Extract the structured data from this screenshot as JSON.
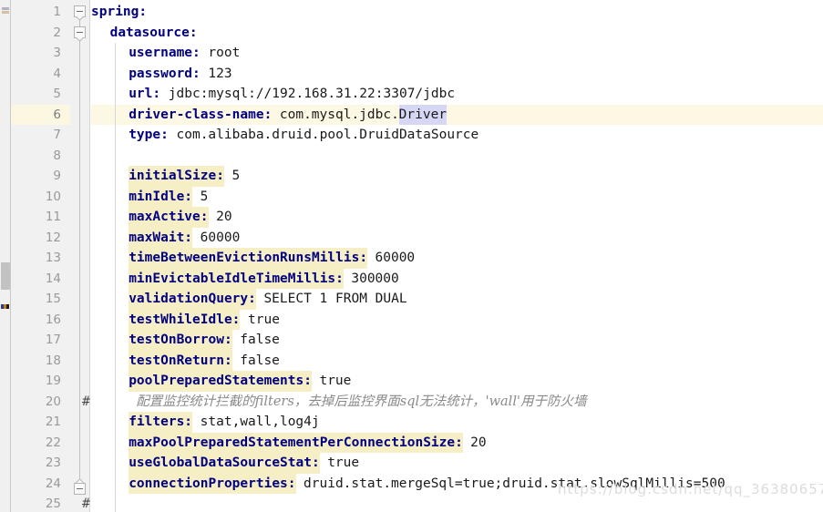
{
  "editor": {
    "language": "yaml",
    "current_line": 6,
    "colors": {
      "key": "#000080",
      "key_highlight_bg": "#f6eec4",
      "value": "#1a1a1a",
      "comment": "#8a8a8a",
      "current_line_bg": "#fdf8e3",
      "gutter_bg": "#f1f1f1",
      "gutter_fg": "#999999",
      "selection_bg": "#d6d6f5",
      "indent_guide": "#d8d8d8"
    }
  },
  "gutter": {
    "line_numbers": [
      "1",
      "2",
      "3",
      "4",
      "5",
      "6",
      "7",
      "8",
      "9",
      "10",
      "11",
      "12",
      "13",
      "14",
      "15",
      "16",
      "17",
      "18",
      "19",
      "20",
      "21",
      "22",
      "23",
      "24",
      "25"
    ]
  },
  "lines": [
    {
      "n": 1,
      "indent": 0,
      "key": "spring:",
      "key_hl": false,
      "value": ""
    },
    {
      "n": 2,
      "indent": 1,
      "key": "datasource:",
      "key_hl": false,
      "value": ""
    },
    {
      "n": 3,
      "indent": 2,
      "key": "username:",
      "key_hl": false,
      "value": "root"
    },
    {
      "n": 4,
      "indent": 2,
      "key": "password:",
      "key_hl": false,
      "value": "123"
    },
    {
      "n": 5,
      "indent": 2,
      "key": "url:",
      "key_hl": false,
      "value": "jdbc:mysql://192.168.31.22:3307/jdbc"
    },
    {
      "n": 6,
      "indent": 2,
      "key": "driver-class-name:",
      "key_hl": false,
      "value": "com.mysql.jdbc.",
      "value_sel": "Driver"
    },
    {
      "n": 7,
      "indent": 2,
      "key": "type:",
      "key_hl": false,
      "value": "com.alibaba.druid.pool.DruidDataSource"
    },
    {
      "n": 8,
      "indent": 0,
      "key": "",
      "key_hl": false,
      "value": ""
    },
    {
      "n": 9,
      "indent": 2,
      "key": "initialSize:",
      "key_hl": true,
      "value": "5"
    },
    {
      "n": 10,
      "indent": 2,
      "key": "minIdle:",
      "key_hl": true,
      "value": "5"
    },
    {
      "n": 11,
      "indent": 2,
      "key": "maxActive:",
      "key_hl": true,
      "value": "20"
    },
    {
      "n": 12,
      "indent": 2,
      "key": "maxWait:",
      "key_hl": true,
      "value": "60000"
    },
    {
      "n": 13,
      "indent": 2,
      "key": "timeBetweenEvictionRunsMillis:",
      "key_hl": true,
      "value": "60000"
    },
    {
      "n": 14,
      "indent": 2,
      "key": "minEvictableIdleTimeMillis:",
      "key_hl": true,
      "value": "300000"
    },
    {
      "n": 15,
      "indent": 2,
      "key": "validationQuery:",
      "key_hl": true,
      "value": "SELECT 1 FROM DUAL"
    },
    {
      "n": 16,
      "indent": 2,
      "key": "testWhileIdle:",
      "key_hl": true,
      "value": "true"
    },
    {
      "n": 17,
      "indent": 2,
      "key": "testOnBorrow:",
      "key_hl": true,
      "value": "false"
    },
    {
      "n": 18,
      "indent": 2,
      "key": "testOnReturn:",
      "key_hl": true,
      "value": "false"
    },
    {
      "n": 19,
      "indent": 2,
      "key": "poolPreparedStatements:",
      "key_hl": true,
      "value": "true"
    },
    {
      "n": 20,
      "indent": 2,
      "comment_hash": "#",
      "comment": "配置监控统计拦截的filters，去掉后监控界面sql无法统计，'wall'用于防火墙"
    },
    {
      "n": 21,
      "indent": 2,
      "key": "filters:",
      "key_hl": true,
      "value": "stat,wall,log4j"
    },
    {
      "n": 22,
      "indent": 2,
      "key": "maxPoolPreparedStatementPerConnectionSize:",
      "key_hl": true,
      "value": "20"
    },
    {
      "n": 23,
      "indent": 2,
      "key": "useGlobalDataSourceStat:",
      "key_hl": true,
      "value": "true"
    },
    {
      "n": 24,
      "indent": 2,
      "key": "connectionProperties:",
      "key_hl": true,
      "value": "druid.stat.mergeSql=true;druid.stat.slowSqlMillis=500"
    },
    {
      "n": 25,
      "indent": 2,
      "comment_hash": "#",
      "comment": ""
    }
  ],
  "watermark": {
    "text": "https://blog.csdn.net/qq_36380657"
  }
}
